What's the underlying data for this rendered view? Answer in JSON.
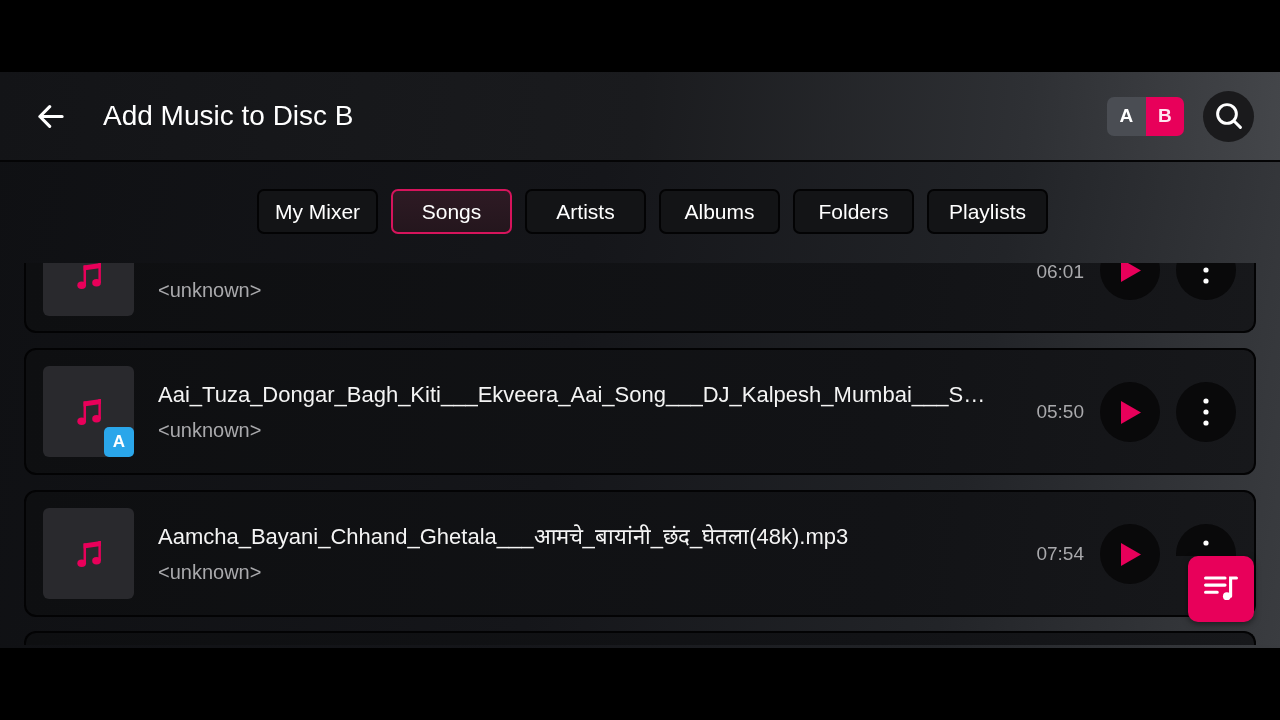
{
  "header": {
    "title": "Add Music to Disc B",
    "disc_toggle": [
      {
        "label": "A",
        "selected": false
      },
      {
        "label": "B",
        "selected": true
      }
    ]
  },
  "tabs": [
    {
      "label": "My Mixer",
      "selected": false
    },
    {
      "label": "Songs",
      "selected": true
    },
    {
      "label": "Artists",
      "selected": false
    },
    {
      "label": "Albums",
      "selected": false
    },
    {
      "label": "Folders",
      "selected": false
    },
    {
      "label": "Playlists",
      "selected": false
    }
  ],
  "songs": [
    {
      "kind": "cut",
      "artist": "<unknown>",
      "duration": "06:01"
    },
    {
      "kind": "full",
      "title": "Aai_Tuza_Dongar_Bagh_Kiti___Ekveera_Aai_Song___DJ_Kalpesh_Mumbai___S…",
      "badge": "A",
      "artist": "<unknown>",
      "duration": "05:50"
    },
    {
      "kind": "full",
      "title": "Aamcha_Bayani_Chhand_Ghetala___आमचे_बायांनी_छंद_घेतला(48k).mp3",
      "artist": "<unknown>",
      "duration": "07:54"
    }
  ]
}
